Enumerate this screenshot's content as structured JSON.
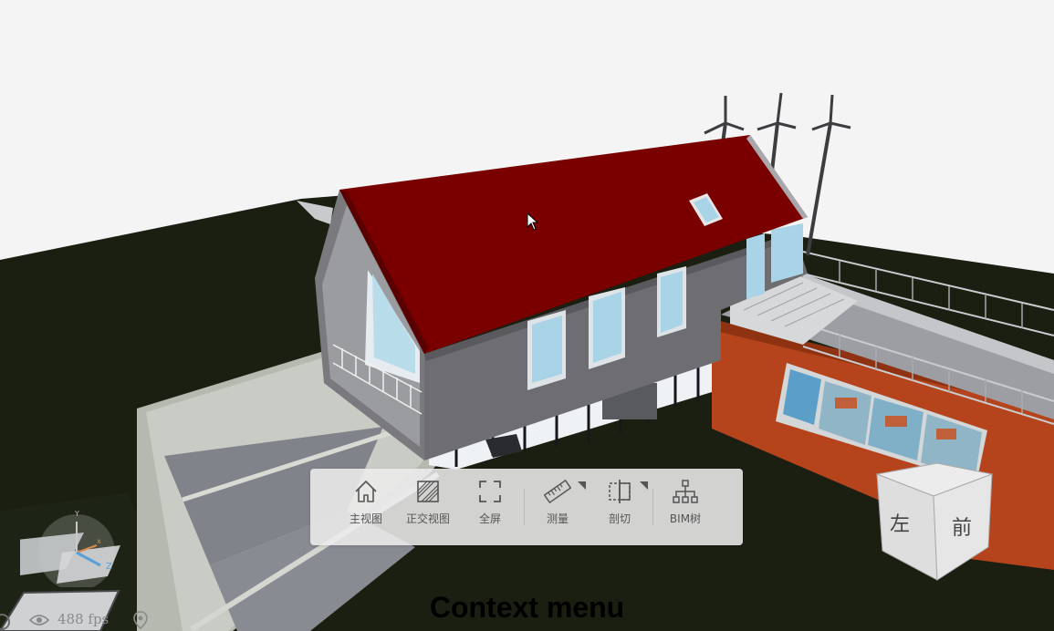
{
  "toolbar": {
    "items": [
      {
        "label": "主视图",
        "icon": "home-icon"
      },
      {
        "label": "正交视图",
        "icon": "orthographic-view-icon"
      },
      {
        "label": "全屏",
        "icon": "fullscreen-icon"
      },
      {
        "label": "测量",
        "icon": "ruler-icon"
      },
      {
        "label": "剖切",
        "icon": "section-cut-icon"
      },
      {
        "label": "BIM树",
        "icon": "tree-hierarchy-icon"
      }
    ]
  },
  "viewcube": {
    "left": "左",
    "front": "前"
  },
  "axis": {
    "x": "x",
    "y": "Y",
    "z": "Z"
  },
  "status": {
    "fps": "488 fps"
  },
  "caption": "Context menu",
  "colors": {
    "roof": "#7a0000",
    "ground": "#1a1f12",
    "wall": "#6e6e72",
    "annex": "#b5441c",
    "toolbar_bg": "#ececec"
  }
}
